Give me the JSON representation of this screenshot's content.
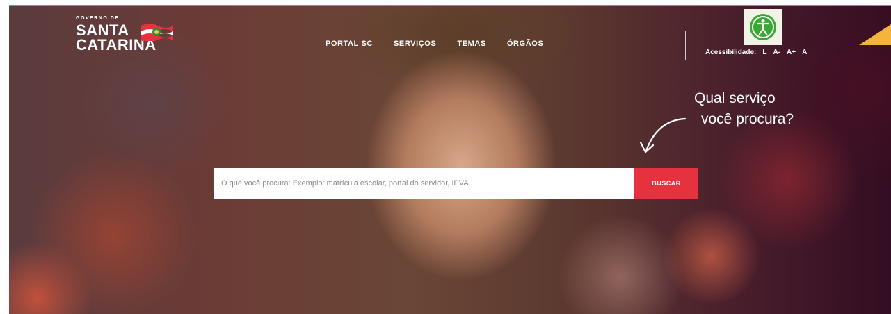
{
  "logo": {
    "top": "GOVERNO DE",
    "line1": "SANTA",
    "line2": "CATARINA",
    "flag_icon": "santa-catarina-flag-icon"
  },
  "nav": {
    "items": [
      {
        "label": "PORTAL SC"
      },
      {
        "label": "SERVIÇOS"
      },
      {
        "label": "TEMAS"
      },
      {
        "label": "ÓRGÃOS"
      }
    ]
  },
  "accessibility": {
    "icon": "accessibility-icon",
    "label": "Acessibilidade:",
    "buttons": [
      "L",
      "A-",
      "A+",
      "A"
    ]
  },
  "prompt": {
    "line1": "Qual serviço",
    "line2": "você procura?",
    "arrow_icon": "curved-arrow-icon"
  },
  "search": {
    "placeholder": "O que você procura: Exemplo: matrícula escolar, portal do servidor, IPVA...",
    "value": "",
    "button_label": "BUSCAR"
  },
  "colors": {
    "accent": "#e6323e",
    "corner": "#f5b43c",
    "access_icon": "#3aa832"
  }
}
